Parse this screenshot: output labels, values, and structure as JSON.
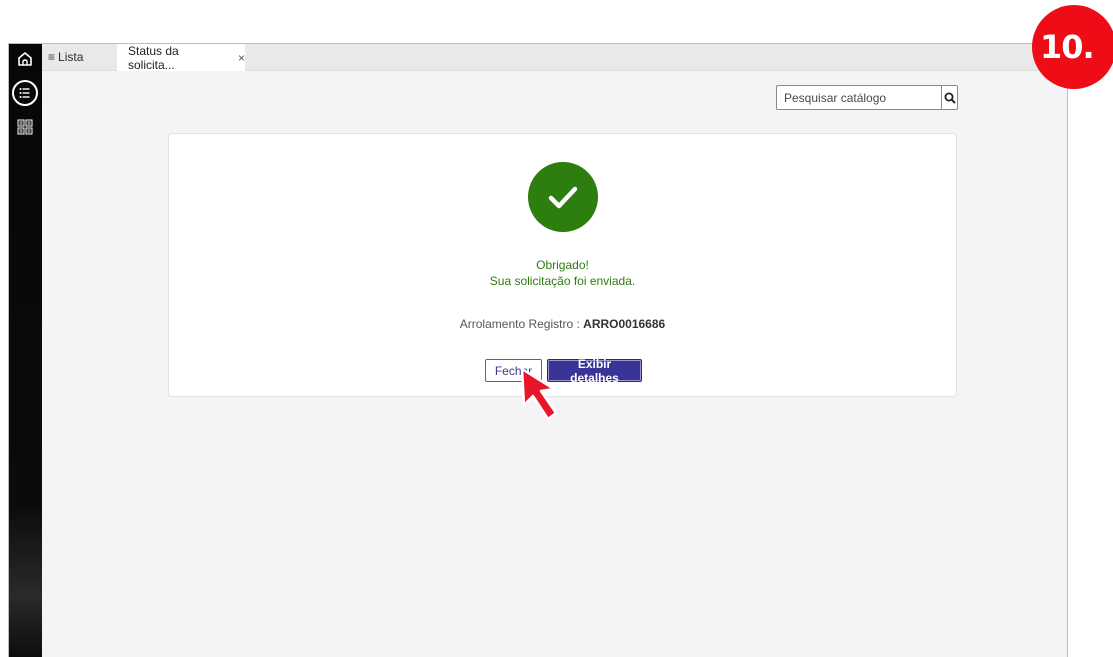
{
  "step_badge": "10.",
  "rail": {
    "icons": [
      "home-icon",
      "list-icon",
      "catalog-grid-icon"
    ]
  },
  "tabs": {
    "list_label": "Lista",
    "active_label": "Status da solicita...",
    "close_glyph": "×"
  },
  "search": {
    "placeholder": "Pesquisar catálogo",
    "value": ""
  },
  "confirmation": {
    "thanks": "Obrigado!",
    "sent_message": "Sua solicitação foi enviada.",
    "record_label": "Arrolamento Registro :",
    "record_number": "ARRO0016686",
    "close_button": "Fechar",
    "details_button": "Exibir detalhes"
  },
  "colors": {
    "success": "#2e7d0f",
    "primary": "#3a3497",
    "badge": "#ee0c16",
    "cursor": "#e8162a"
  }
}
